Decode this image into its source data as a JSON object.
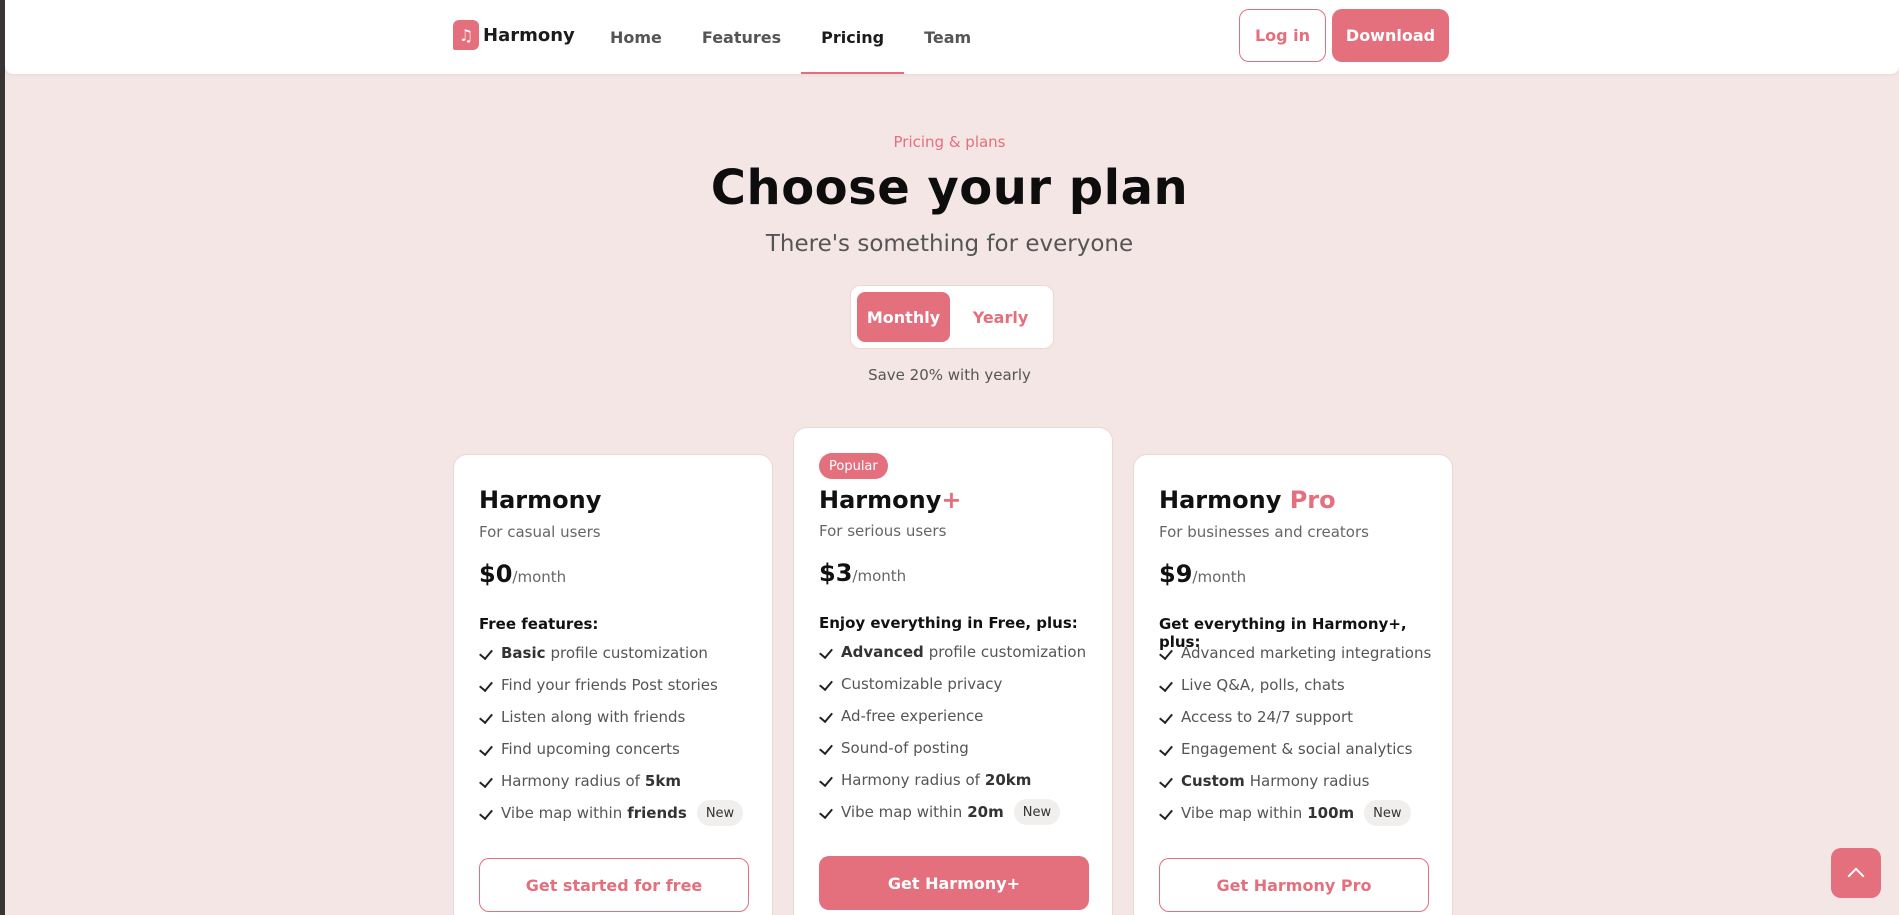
{
  "brand": {
    "name": "Harmony",
    "logo_icon": "music-note-icon"
  },
  "nav": {
    "links": [
      {
        "label": "Home"
      },
      {
        "label": "Features"
      },
      {
        "label": "Pricing",
        "active": true
      },
      {
        "label": "Team"
      }
    ],
    "login_label": "Log in",
    "download_label": "Download"
  },
  "hero": {
    "eyebrow": "Pricing & plans",
    "title": "Choose your plan",
    "subtitle": "There's something for everyone",
    "toggle": {
      "monthly": "Monthly",
      "yearly": "Yearly",
      "selected": "Monthly"
    },
    "save_note": "Save 20% with yearly"
  },
  "plans": [
    {
      "name": "Harmony",
      "name_accent": "",
      "description": "For casual users",
      "price": "$0",
      "period": "/month",
      "features_heading": "Free features:",
      "features": [
        {
          "pre": "",
          "bold": "Basic",
          "text": "profile customization",
          "tag": ""
        },
        {
          "pre": "",
          "bold": "",
          "text": "Find your friends Post stories",
          "tag": ""
        },
        {
          "pre": "",
          "bold": "",
          "text": "Listen along with friends",
          "tag": ""
        },
        {
          "pre": "",
          "bold": "",
          "text": "Find upcoming concerts",
          "tag": ""
        },
        {
          "pre": "Harmony radius of",
          "bold": "5km",
          "text": "",
          "tag": ""
        },
        {
          "pre": "Vibe map within",
          "bold": "friends",
          "text": "",
          "tag": "New"
        }
      ],
      "cta": "Get started for free"
    },
    {
      "name": "Harmony",
      "name_accent": "+",
      "badge": "Popular",
      "description": "For serious users",
      "price": "$3",
      "period": "/month",
      "features_heading": "Enjoy everything in Free, plus:",
      "features": [
        {
          "pre": "",
          "bold": "Advanced",
          "text": "profile customization",
          "tag": ""
        },
        {
          "pre": "",
          "bold": "",
          "text": "Customizable privacy",
          "tag": ""
        },
        {
          "pre": "",
          "bold": "",
          "text": "Ad-free experience",
          "tag": ""
        },
        {
          "pre": "",
          "bold": "",
          "text": "Sound-of posting",
          "tag": ""
        },
        {
          "pre": "Harmony radius of",
          "bold": "20km",
          "text": "",
          "tag": ""
        },
        {
          "pre": "Vibe map within",
          "bold": "20m",
          "text": "",
          "tag": "New"
        }
      ],
      "cta": "Get Harmony+"
    },
    {
      "name": "Harmony",
      "name_accent": "Pro",
      "description": "For businesses and creators",
      "price": "$9",
      "period": "/month",
      "features_heading": "Get everything in Harmony+, plus:",
      "features": [
        {
          "pre": "",
          "bold": "",
          "text": "Advanced marketing integrations",
          "tag": ""
        },
        {
          "pre": "",
          "bold": "",
          "text": "Live Q&A, polls, chats",
          "tag": ""
        },
        {
          "pre": "",
          "bold": "",
          "text": "Access to 24/7 support",
          "tag": ""
        },
        {
          "pre": "",
          "bold": "",
          "text": "Engagement & social analytics",
          "tag": ""
        },
        {
          "pre": "",
          "bold": "Custom",
          "text": "Harmony radius",
          "tag": ""
        },
        {
          "pre": "Vibe map within",
          "bold": "100m",
          "text": "",
          "tag": "New"
        }
      ],
      "cta": "Get Harmony Pro"
    }
  ],
  "scroll_top_icon": "chevron-up-icon",
  "colors": {
    "accent": "#e46f7d",
    "background": "#f5e6e6"
  }
}
